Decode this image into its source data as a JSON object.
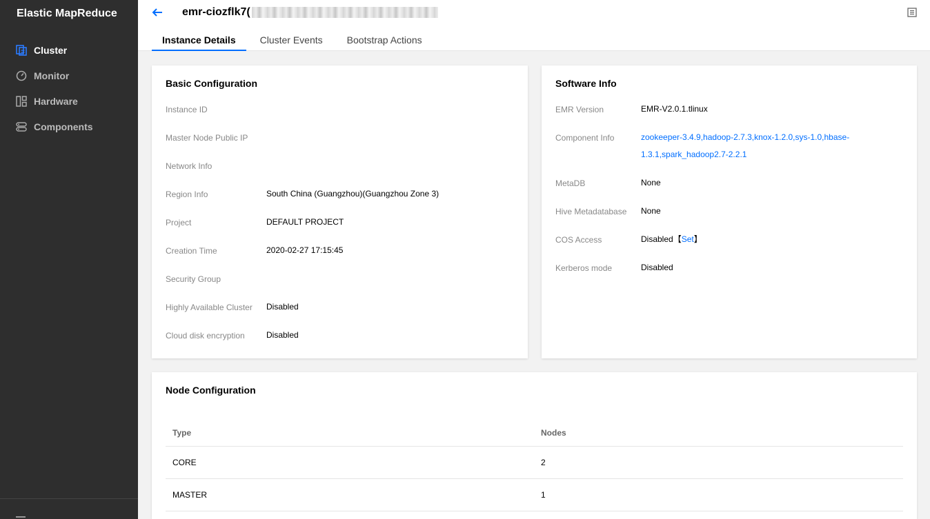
{
  "sidebar": {
    "brand": "Elastic MapReduce",
    "items": [
      {
        "label": "Cluster",
        "icon": "cluster-icon"
      },
      {
        "label": "Monitor",
        "icon": "monitor-icon"
      },
      {
        "label": "Hardware",
        "icon": "hardware-icon"
      },
      {
        "label": "Components",
        "icon": "components-icon"
      }
    ]
  },
  "header": {
    "title": "emr-ciozflk7(",
    "tabs": [
      "Instance Details",
      "Cluster Events",
      "Bootstrap Actions"
    ]
  },
  "basic": {
    "title": "Basic Configuration",
    "rows": [
      {
        "label": "Instance ID",
        "value": ""
      },
      {
        "label": "Master Node Public IP",
        "value": ""
      },
      {
        "label": "Network Info",
        "value": ""
      },
      {
        "label": "Region Info",
        "value": "South China (Guangzhou)(Guangzhou Zone 3)"
      },
      {
        "label": "Project",
        "value": "DEFAULT PROJECT"
      },
      {
        "label": "Creation Time",
        "value": "2020-02-27 17:15:45"
      },
      {
        "label": "Security Group",
        "value": ""
      },
      {
        "label": "Highly Available Cluster",
        "value": "Disabled"
      },
      {
        "label": "Cloud disk encryption",
        "value": "Disabled"
      }
    ]
  },
  "software": {
    "title": "Software Info",
    "emr_version_label": "EMR Version",
    "emr_version": "EMR-V2.0.1.tlinux",
    "component_label": "Component Info",
    "component_line1": "zookeeper-3.4.9,hadoop-2.7.3,knox-1.2.0,sys-1.0,hbase-",
    "component_line2": "1.3.1,spark_hadoop2.7-2.2.1",
    "metadb_label": "MetaDB",
    "metadb": "None",
    "hive_label": "Hive Metadatabase",
    "hive": "None",
    "cos_label": "COS Access",
    "cos": "Disabled",
    "cos_bracket_open": "【",
    "cos_set": "Set",
    "cos_bracket_close": "】",
    "kerberos_label": "Kerberos mode",
    "kerberos": "Disabled"
  },
  "node": {
    "title": "Node Configuration",
    "columns": [
      "Type",
      "Nodes"
    ],
    "rows": [
      {
        "type": "CORE",
        "nodes": "2"
      },
      {
        "type": "MASTER",
        "nodes": "1"
      }
    ]
  },
  "colors": {
    "accent": "#006eff",
    "sidebar_bg": "#2e2e2e",
    "page_bg": "#f2f2f2"
  }
}
